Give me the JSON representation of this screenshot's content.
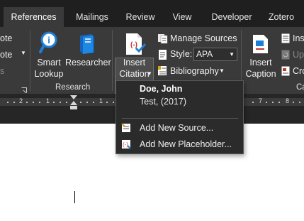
{
  "tabs": [
    {
      "label": "References",
      "active": true
    },
    {
      "label": "Mailings"
    },
    {
      "label": "Review"
    },
    {
      "label": "View"
    },
    {
      "label": "Developer"
    },
    {
      "label": "Zotero"
    }
  ],
  "ribbon": {
    "left_partial": {
      "line1": "ote",
      "line2": "ote",
      "line3": "s"
    },
    "research": {
      "group_label": "Research",
      "smart_lookup_line1": "Smart",
      "smart_lookup_line2": "Lookup",
      "researcher": "Researcher"
    },
    "citations": {
      "insert_citation_line1": "Insert",
      "insert_citation_line2": "Citation",
      "manage_sources": "Manage Sources",
      "style_label": "Style:",
      "style_value": "APA",
      "bibliography": "Bibliography"
    },
    "captions": {
      "insert_caption_line1": "Insert",
      "insert_caption_line2": "Caption",
      "ins_partial": "Ins",
      "up_partial": "Up",
      "cro_partial": "Cro",
      "group_label_partial": "Ca"
    }
  },
  "ruler": {
    "numbers": [
      "2",
      "1",
      "1",
      "7",
      "8"
    ]
  },
  "citation_menu": {
    "source_author": "Doe, John",
    "source_detail": "Test, (2017)",
    "add_new_source": "Add New Source...",
    "add_new_placeholder": "Add New Placeholder..."
  },
  "colors": {
    "tab_bar": "#1f1f1f",
    "ribbon": "#3a3a3a",
    "accent_blue": "#1e7ed6",
    "accent_red": "#c0392b"
  }
}
